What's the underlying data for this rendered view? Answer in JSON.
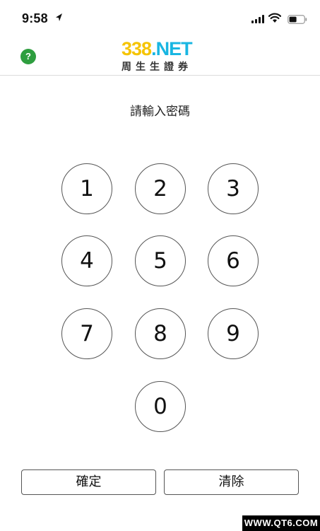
{
  "status_bar": {
    "time": "9:58",
    "icons": [
      "location-arrow-icon",
      "signal-icon",
      "wifi-icon",
      "battery-icon"
    ]
  },
  "header": {
    "help_label": "?",
    "logo_number": "338",
    "logo_suffix": ".NET",
    "logo_subtitle": "周生生證券",
    "colors": {
      "help": "#2e9e3f",
      "logo_number": "#f5c400",
      "logo_suffix": "#19b6e2"
    }
  },
  "prompt": "請輸入密碼",
  "keypad": {
    "keys": [
      "1",
      "2",
      "3",
      "4",
      "5",
      "6",
      "7",
      "8",
      "9",
      "0"
    ]
  },
  "actions": {
    "confirm": "確定",
    "clear": "清除"
  },
  "watermark": "WWW.QT6.COM"
}
